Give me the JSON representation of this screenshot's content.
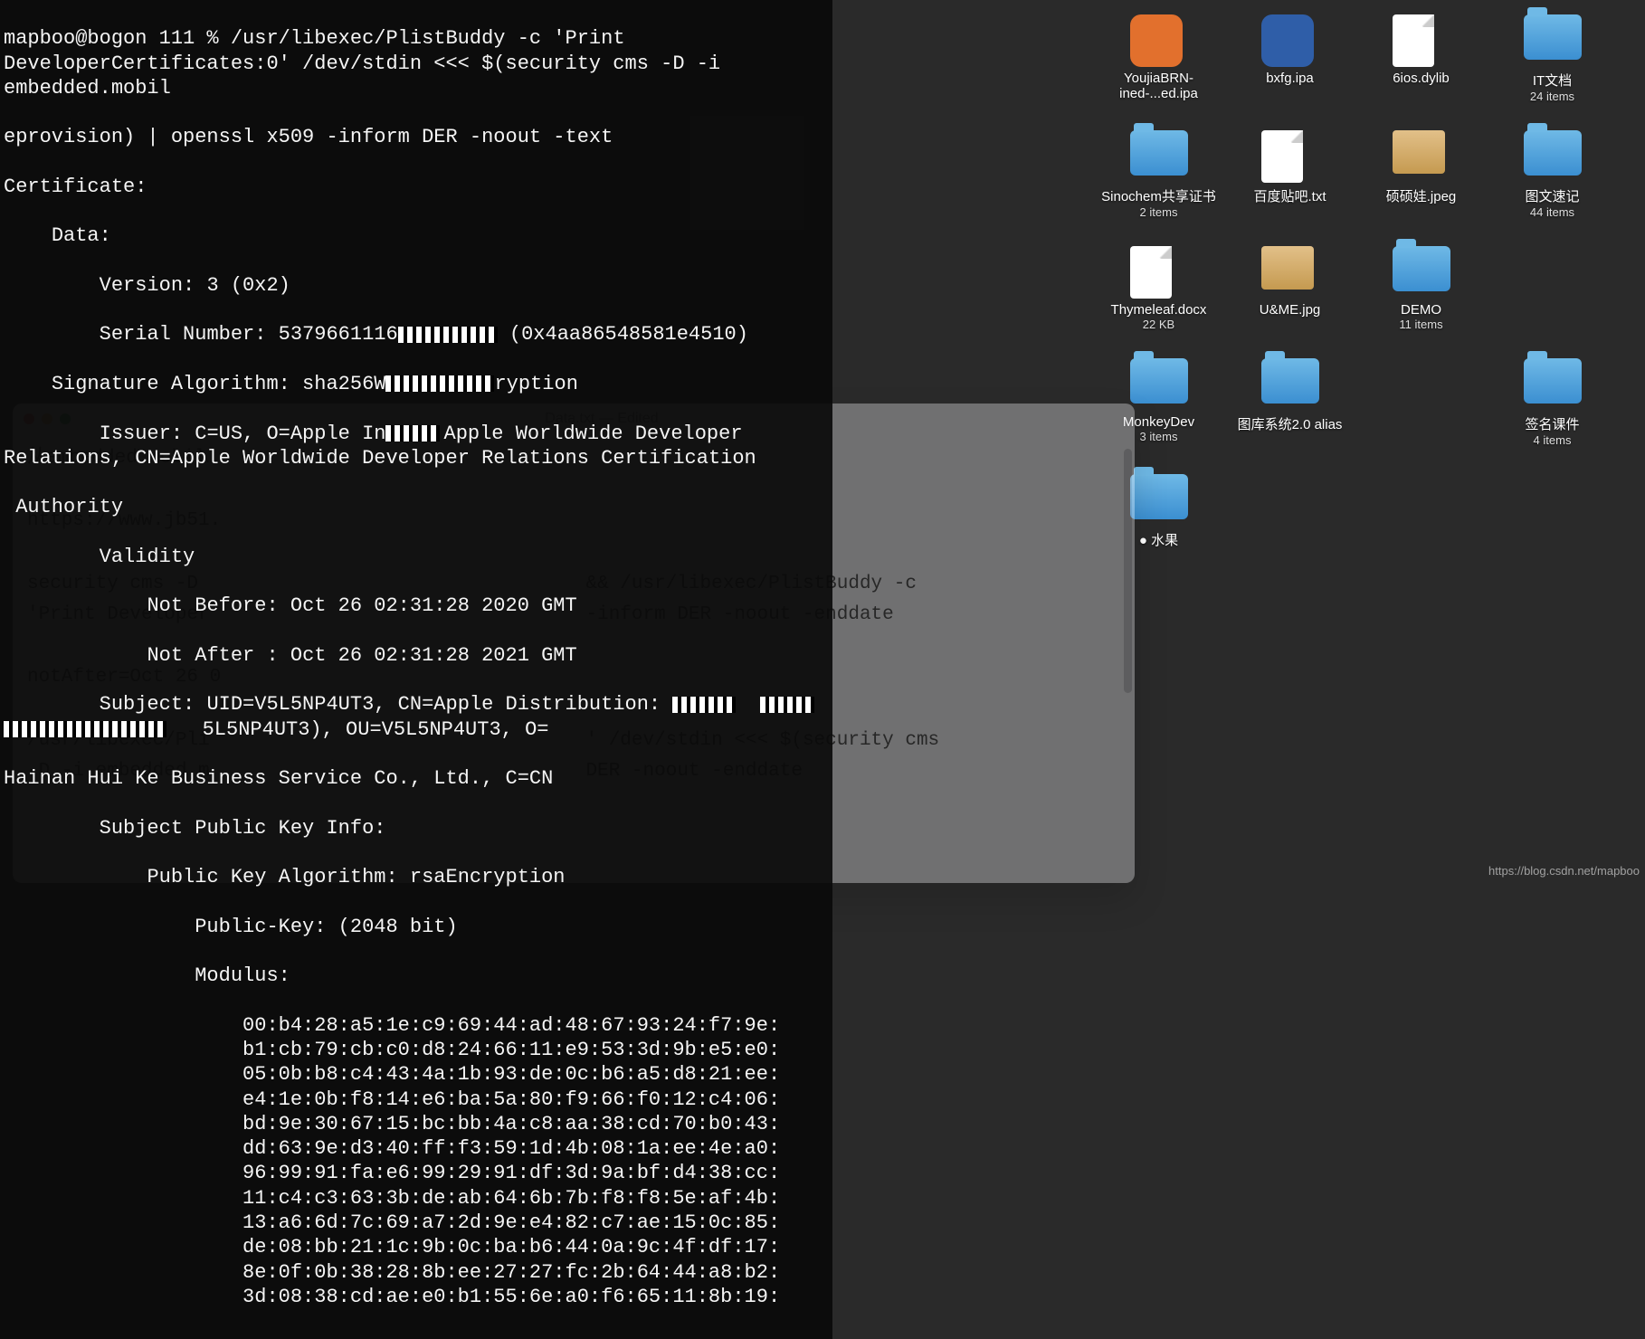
{
  "desktop": {
    "items": [
      {
        "label": "YoujiaBRN-ined-...ed.ipa",
        "sub": "",
        "kind": "orange"
      },
      {
        "label": "bxfg.ipa",
        "sub": "",
        "kind": "blue"
      },
      {
        "label": "6ios.dylib",
        "sub": "",
        "kind": "file"
      },
      {
        "label": "IT文档",
        "sub": "24 items",
        "kind": "folder"
      },
      {
        "label": "Sinochem共享证书",
        "sub": "2 items",
        "kind": "folder"
      },
      {
        "label": "百度贴吧.txt",
        "sub": "",
        "kind": "file"
      },
      {
        "label": "硕硕娃.jpeg",
        "sub": "",
        "kind": "img"
      },
      {
        "label": "图文速记",
        "sub": "44 items",
        "kind": "folder"
      },
      {
        "label": "Thymeleaf.docx",
        "sub": "22 KB",
        "kind": "file"
      },
      {
        "label": "U&ME.jpg",
        "sub": "",
        "kind": "img"
      },
      {
        "label": "DEMO",
        "sub": "11 items",
        "kind": "folder"
      },
      {
        "label": "",
        "sub": "",
        "kind": "spacer"
      },
      {
        "label": "MonkeyDev",
        "sub": "3 items",
        "kind": "folder"
      },
      {
        "label": "图库系统2.0 alias",
        "sub": "",
        "kind": "folder"
      },
      {
        "label": "",
        "sub": "",
        "kind": "spacer"
      },
      {
        "label": "签名课件",
        "sub": "4 items",
        "kind": "folder"
      },
      {
        "label": "● 水果",
        "sub": "",
        "kind": "folder"
      },
      {
        "label": "",
        "sub": "",
        "kind": "spacer"
      }
    ]
  },
  "textedit": {
    "title": "Data.txt — Edited",
    "body": "从embedded.mobil…\n\nhttps://www.jb51.\n\nsecurity cms -D                                  && /usr/libexec/PlistBuddy -c\n'Print Developer                                 -inform DER -noout -enddate\n\nnotAfter=Oct 26 0\n\n/usr/libexec/Pli                                 ' /dev/stdin <<< $(security cms\n-D -i embedded.m                                 DER -noout -enddate"
  },
  "terminal": {
    "prompt": "mapboo@bogon 111 % ",
    "cmd1": "/usr/libexec/PlistBuddy -c 'Print DeveloperCertificates:0' /dev/stdin <<< $(security cms -D -i embedded.mobil",
    "cmd2": "eprovision) | openssl x509 -inform DER -noout -text",
    "cert_header": "Certificate:",
    "data_header": "    Data:",
    "version": "        Version: 3 (0x2)",
    "serial": "        Serial Number: 5379661116",
    "serial_hex": " (0x4aa86548581e4510)",
    "sigalg_pre": "    Signature Algorithm: sha256W",
    "sigalg_post": "ryption",
    "issuer": "        Issuer: C=US, O=Apple In",
    "issuer_mid": "pple Worldwide Developer Relations, CN=",
    "issuer_tail": "Apple Worldwide Developer Relations Certification",
    "authority": " Authority",
    "validity": "        Validity",
    "not_before": "            Not Before: Oct 26 02:31:28 2020 GMT",
    "not_after": "            Not After : Oct 26 02:31:28 2021 GMT",
    "subject_pre": "        Subject: UID=V5L5NP4UT3, CN=Apple Distribution: ",
    "subject_mid": "5L5NP4UT3), OU=V5L5NP4UT3, O=",
    "subject2": "Hainan Hui Ke Business Service Co., Ltd., C=CN",
    "spki": "        Subject Public Key Info:",
    "pkalg": "            Public Key Algorithm: rsaEncryption",
    "pkbits": "                Public-Key: (2048 bit)",
    "modulus": "                Modulus:",
    "mod_lines": [
      "                    00:b4:28:a5:1e:c9:69:44:ad:48:67:93:24:f7:9e:",
      "                    b1:cb:79:cb:c0:d8:24:66:11:e9:53:3d:9b:e5:e0:",
      "                    05:0b:b8:c4:43:4a:1b:93:de:0c:b6:a5:d8:21:ee:",
      "                    e4:1e:0b:f8:14:e6:ba:5a:80:f9:66:f0:12:c4:06:",
      "                    bd:9e:30:67:15:bc:bb:4a:c8:aa:38:cd:70:b0:43:",
      "                    dd:63:9e:d3:40:ff:f3:59:1d:4b:08:1a:ee:4e:a0:",
      "                    96:99:91:fa:e6:99:29:91:df:3d:9a:bf:d4:38:cc:",
      "                    11:c4:c3:63:3b:de:ab:64:6b:7b:f8:f8:5e:af:4b:",
      "                    13:a6:6d:7c:69:a7:2d:9e:e4:82:c7:ae:15:0c:85:",
      "                    de:08:bb:21:1c:9b:0c:ba:b6:44:0a:9c:4f:df:17:",
      "                    8e:0f:0b:38:28:8b:ee:27:27:fc:2b:64:44:a8:b2:",
      "                    3d:08:38:cd:ae:e0:b1:55:6e:a0:f6:65:11:8b:19:"
    ],
    "bg_obi": "obi",
    "bg_plist": ".plist"
  },
  "watermark": "https://blog.csdn.net/mapboo"
}
